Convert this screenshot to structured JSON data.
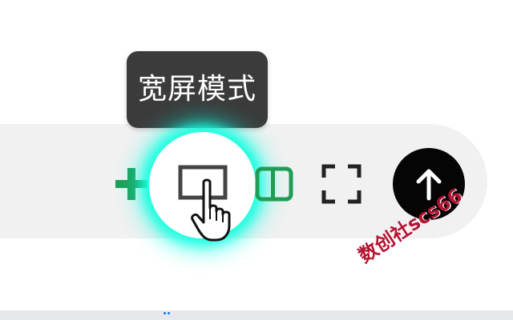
{
  "tooltip": {
    "text": "宽屏模式"
  },
  "toolbar": {
    "buttons": [
      {
        "id": "add",
        "icon": "plus-icon",
        "color": "#1f9d55"
      },
      {
        "id": "widescreen",
        "icon": "widescreen-icon",
        "color": "#444444",
        "state": "hovered"
      },
      {
        "id": "split-view",
        "icon": "split-view-icon",
        "color": "#1f9d55"
      },
      {
        "id": "fullscreen",
        "icon": "fullscreen-icon",
        "color": "#222222"
      },
      {
        "id": "back-to-top",
        "icon": "arrow-up-icon",
        "color": "#000000"
      }
    ],
    "highlight_color": "#1affe0"
  },
  "cursor": {
    "icon": "hand-pointer-icon"
  },
  "watermark": {
    "text": "数创社scs66",
    "color": "#b41432"
  }
}
